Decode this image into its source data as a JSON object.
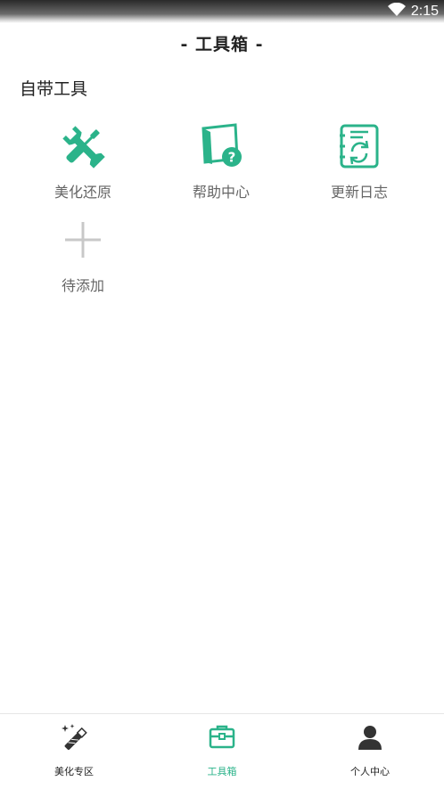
{
  "status_bar": {
    "time": "2:15"
  },
  "header": {
    "title": "- 工具箱 -"
  },
  "section": {
    "title": "自带工具"
  },
  "tools": [
    {
      "label": "美化还原",
      "icon": "wrench-screwdriver-icon"
    },
    {
      "label": "帮助中心",
      "icon": "help-note-icon"
    },
    {
      "label": "更新日志",
      "icon": "update-log-icon"
    },
    {
      "label": "待添加",
      "icon": "plus-icon"
    }
  ],
  "bottom_nav": {
    "items": [
      {
        "label": "美化专区",
        "icon": "magic-wand-icon",
        "active": false
      },
      {
        "label": "工具箱",
        "icon": "toolbox-icon",
        "active": true
      },
      {
        "label": "个人中心",
        "icon": "person-icon",
        "active": false
      }
    ]
  },
  "colors": {
    "accent": "#2bb38a",
    "text": "#222222",
    "muted": "#666666",
    "plus": "#c8c8c8"
  }
}
